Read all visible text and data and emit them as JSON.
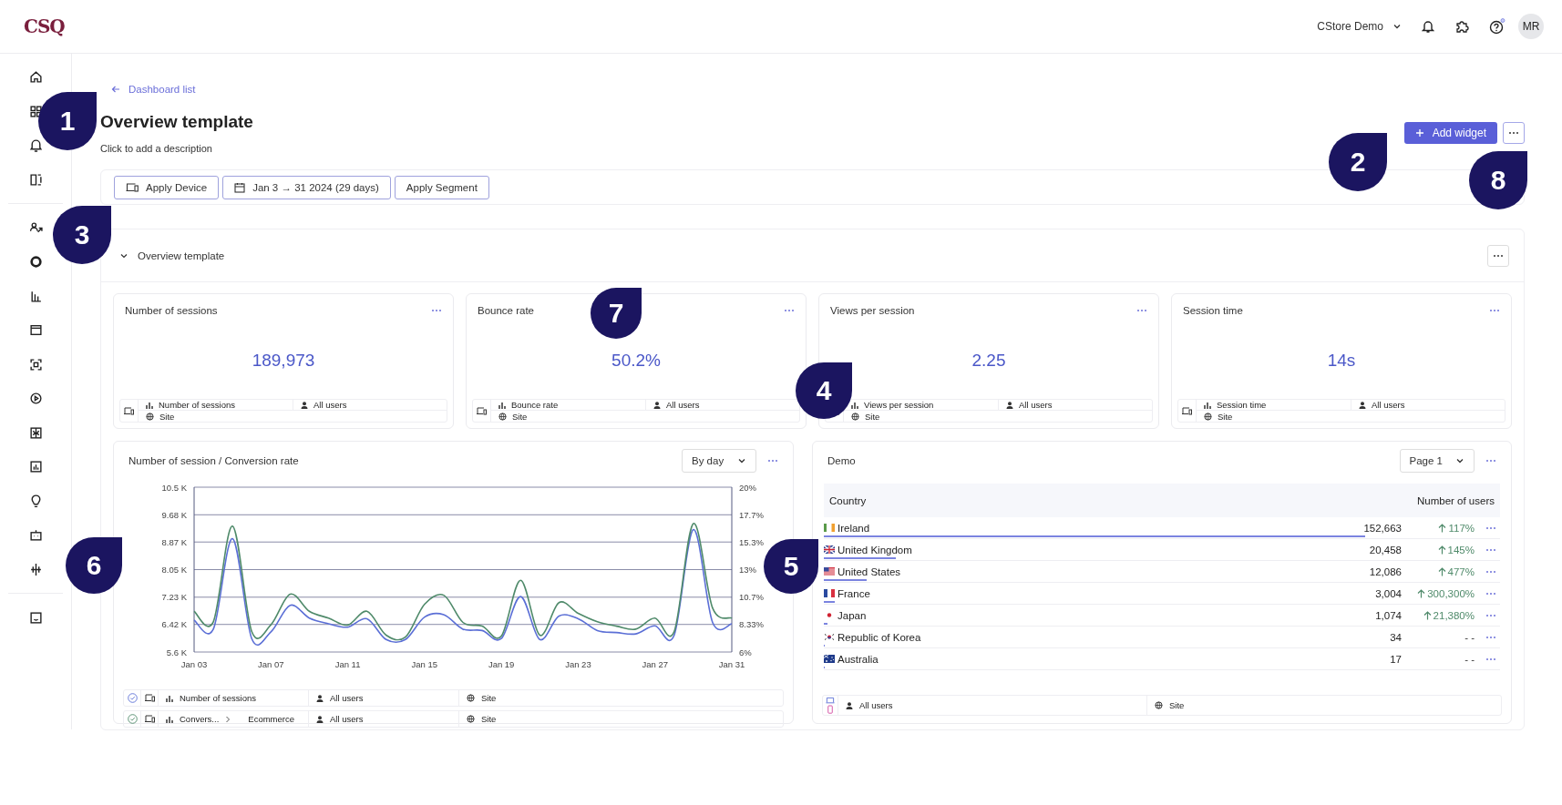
{
  "topbar": {
    "logo": "CSQ",
    "workspace": "CStore Demo",
    "avatar": "MR"
  },
  "breadcrumb": "Dashboard list",
  "title": "Overview template",
  "description": "Click to add a description",
  "actions": {
    "add_widget": "Add widget"
  },
  "filters": [
    {
      "kind": "device",
      "label": "Apply Device"
    },
    {
      "kind": "date",
      "label": "Jan 3 → 31 2024 (29 days)"
    },
    {
      "kind": "segment",
      "label": "Apply Segment"
    }
  ],
  "section": {
    "title": "Overview template",
    "expanded": true,
    "kpis": [
      {
        "title": "Number of sessions",
        "value": "189,973",
        "metric": "Number of sessions",
        "segment": "All users",
        "scope": "Site"
      },
      {
        "title": "Bounce rate",
        "value": "50.2%",
        "metric": "Bounce rate",
        "segment": "All users",
        "scope": "Site"
      },
      {
        "title": "Views per session",
        "value": "2.25",
        "metric": "Views per session",
        "segment": "All users",
        "scope": "Site"
      },
      {
        "title": "Session time",
        "value": "14s",
        "metric": "Session time",
        "segment": "All users",
        "scope": "Site"
      }
    ],
    "chart": {
      "title": "Number of session / Conversion rate",
      "granularity": "By day",
      "chart_data": {
        "type": "line",
        "categories": [
          "Jan 03",
          null,
          null,
          null,
          "Jan 07",
          null,
          null,
          null,
          "Jan 11",
          null,
          null,
          null,
          "Jan 15",
          null,
          null,
          null,
          "Jan 19",
          null,
          null,
          null,
          "Jan 23",
          null,
          null,
          null,
          "Jan 27",
          null,
          null,
          null,
          "Jan 31"
        ],
        "series": [
          {
            "name": "Number of sessions",
            "color": "#5b6fd6",
            "values": [
              6.55,
              6.28,
              8.97,
              6.0,
              6.2,
              6.99,
              6.61,
              6.44,
              6.34,
              6.59,
              5.97,
              5.97,
              6.64,
              6.71,
              6.28,
              6.24,
              6.0,
              7.25,
              5.97,
              6.67,
              6.59,
              6.24,
              6.18,
              6.14,
              6.38,
              6.1,
              9.24,
              6.48,
              6.44
            ]
          },
          {
            "name": "Convers...",
            "color": "#4f8a6a",
            "values": [
              6.81,
              6.5,
              9.34,
              6.21,
              6.41,
              7.32,
              6.81,
              6.61,
              6.4,
              6.81,
              6.1,
              6.04,
              7.02,
              7.29,
              6.48,
              6.37,
              6.07,
              7.73,
              6.1,
              7.07,
              6.75,
              6.5,
              6.37,
              6.28,
              6.61,
              6.21,
              9.42,
              6.91,
              6.61
            ]
          }
        ],
        "ylim": [
          5.6,
          10.5
        ],
        "yticks": [
          {
            "value": 10.5,
            "label": "10.5 K"
          },
          {
            "value": 9.68,
            "label": "9.68 K"
          },
          {
            "value": 8.87,
            "label": "8.87 K"
          },
          {
            "value": 8.05,
            "label": "8.05 K"
          },
          {
            "value": 7.23,
            "label": "7.23 K"
          },
          {
            "value": 6.42,
            "label": "6.42 K"
          },
          {
            "value": 5.6,
            "label": "5.6 K"
          }
        ],
        "grid": true
      },
      "right_axis_labels": [
        "20%",
        "17.7%",
        "15.3%",
        "13%",
        "10.7%",
        "8.33%",
        "6%"
      ],
      "legend": [
        {
          "segment": "All users",
          "scope": "Site"
        },
        {
          "sub": "Ecommerce",
          "segment": "All users",
          "scope": "Site"
        }
      ]
    },
    "table": {
      "title": "Demo",
      "page": "Page 1",
      "columns": [
        "Country",
        "Number of users"
      ],
      "rows": [
        {
          "country": "Ireland",
          "users": "152,663",
          "kind": "up",
          "change": "117%",
          "level": 0.8
        },
        {
          "country": "United Kingdom",
          "users": "20,458",
          "kind": "up",
          "change": "145%",
          "level": 0.107
        },
        {
          "country": "United States",
          "users": "12,086",
          "kind": "up",
          "change": "477%",
          "level": 0.063
        },
        {
          "country": "France",
          "users": "3,004",
          "kind": "up",
          "change": "300,300%",
          "level": 0.016
        },
        {
          "country": "Japan",
          "users": "1,074",
          "kind": "up",
          "change": "21,380%",
          "level": 0.006
        },
        {
          "country": "Republic of Korea",
          "users": "34",
          "kind": "none",
          "change": "- -",
          "level": 0.002
        },
        {
          "country": "Australia",
          "users": "17",
          "kind": "none",
          "change": "- -",
          "level": 0.002
        }
      ],
      "segment": "All users",
      "scope": "Site"
    }
  },
  "markers": [
    "1",
    "2",
    "3",
    "4",
    "5",
    "6",
    "7",
    "8"
  ]
}
